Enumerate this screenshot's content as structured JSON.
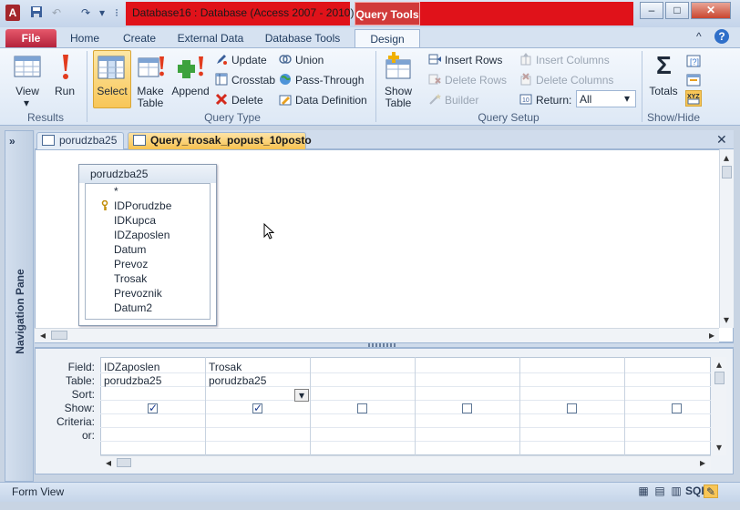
{
  "titlebar": {
    "title": "Database16 : Database (Access 2007 - 2010)",
    "context_tab": "Query Tools",
    "minimize": "–",
    "maximize": "□",
    "close": "✕"
  },
  "ribbon_tabs": [
    "File",
    "Home",
    "Create",
    "External Data",
    "Database Tools",
    "Design"
  ],
  "help_glyphs": {
    "collapse": "^",
    "help": "?"
  },
  "ribbon": {
    "results": {
      "label": "Results",
      "view": "View",
      "run": "Run"
    },
    "query_type": {
      "label": "Query Type",
      "select": "Select",
      "make_table": "Make Table",
      "make_table_l1": "Make",
      "make_table_l2": "Table",
      "append": "Append",
      "update": "Update",
      "crosstab": "Crosstab",
      "delete": "Delete",
      "union": "Union",
      "pass_through": "Pass-Through",
      "data_definition": "Data Definition"
    },
    "query_setup": {
      "label": "Query Setup",
      "show_table_l1": "Show",
      "show_table_l2": "Table",
      "insert_rows": "Insert Rows",
      "delete_rows": "Delete Rows",
      "builder": "Builder",
      "insert_columns": "Insert Columns",
      "delete_columns": "Delete Columns",
      "return_label": "Return:",
      "return_value": "All"
    },
    "show_hide": {
      "label": "Show/Hide",
      "totals": "Totals"
    }
  },
  "nav_pane": {
    "label": "Navigation Pane",
    "toggle": "»"
  },
  "doc_tabs": [
    "porudzba25",
    "Query_trosak_popust_10posto"
  ],
  "doc_close": "✕",
  "table_box": {
    "title": "porudzba25",
    "fields": [
      "*",
      "IDPorudzbe",
      "IDKupca",
      "IDZaposlen",
      "Datum",
      "Prevoz",
      "Trosak",
      "Prevoznik",
      "Datum2"
    ]
  },
  "grid": {
    "row_labels": [
      "Field:",
      "Table:",
      "Sort:",
      "Show:",
      "Criteria:",
      "or:"
    ],
    "columns": [
      {
        "field": "IDZaposlen",
        "table": "porudzba25",
        "show": true
      },
      {
        "field": "Trosak",
        "table": "porudzba25",
        "show": true
      },
      {
        "field": "",
        "table": "",
        "show": false
      },
      {
        "field": "",
        "table": "",
        "show": false
      },
      {
        "field": "",
        "table": "",
        "show": false
      },
      {
        "field": "",
        "table": "",
        "show": false
      }
    ]
  },
  "statusbar": {
    "text": "Form View",
    "view_sql": "SQL"
  }
}
